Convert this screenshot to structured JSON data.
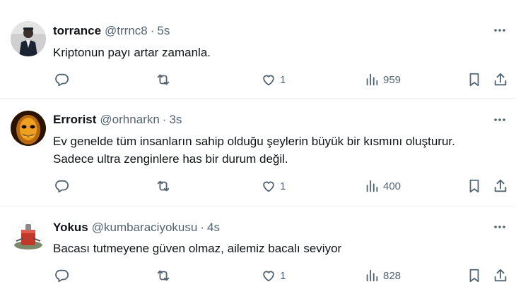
{
  "tweets": [
    {
      "name": "torrance",
      "handle": "@trrnc8",
      "separator": "·",
      "time": "5s",
      "text_lines": [
        "Kriptonun payı artar zamanla."
      ],
      "likes": "1",
      "views": "959",
      "avatar_colors": {
        "bg": "#cfcfcf",
        "figure": "#1c2433"
      }
    },
    {
      "name": "Errorist",
      "handle": "@orhnarkn",
      "separator": "·",
      "time": "3s",
      "text_lines": [
        "Ev genelde tüm insanların sahip olduğu şeylerin büyük bir kısmını oluşturur.",
        "Sadece ultra zenginlere has bir durum değil."
      ],
      "likes": "1",
      "views": "400",
      "avatar_colors": {
        "bg": "#2a1400",
        "figure": "#f0a020"
      }
    },
    {
      "name": "Yokus",
      "handle": "@kumbaraciyokusu",
      "separator": "·",
      "time": "4s",
      "text_lines": [
        "Bacası tutmeyene güven olmaz, ailemiz bacalı seviyor"
      ],
      "likes": "1",
      "views": "828",
      "avatar_colors": {
        "bg": "#ffffff",
        "figure": "#c0392b"
      }
    }
  ],
  "colors": {
    "text": "#0f1419",
    "secondary": "#536471",
    "divider": "#eff3f4"
  },
  "icons": [
    "more-icon",
    "reply-icon",
    "retweet-icon",
    "like-icon",
    "views-icon",
    "bookmark-icon",
    "share-icon"
  ]
}
